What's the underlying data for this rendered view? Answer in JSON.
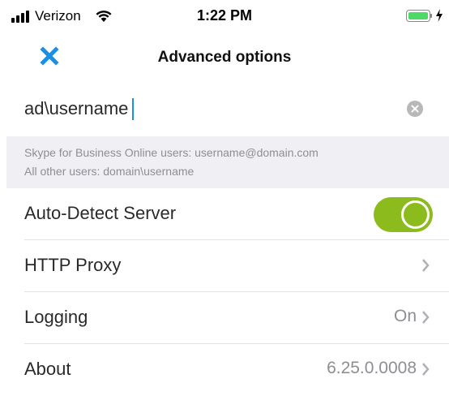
{
  "status_bar": {
    "carrier": "Verizon",
    "time": "1:22 PM",
    "battery_color": "#4cd964"
  },
  "nav": {
    "title": "Advanced options",
    "close_icon": "close-x-icon",
    "close_color": "#1a8fe3"
  },
  "username": {
    "value": "ad\\username",
    "clear_icon": "clear-circle-icon"
  },
  "hints": {
    "line1": "Skype for Business Online users: username@domain.com",
    "line2": "All other users: domain\\username"
  },
  "settings": [
    {
      "label": "Auto-Detect Server",
      "control": "toggle",
      "enabled": true,
      "toggle_color": "#8cbb1e"
    },
    {
      "label": "HTTP Proxy",
      "value": "",
      "icon": "chevron-right-icon"
    },
    {
      "label": "Logging",
      "value": "On",
      "icon": "chevron-right-icon"
    },
    {
      "label": "About",
      "value": "6.25.0.0008",
      "icon": "chevron-right-icon"
    }
  ]
}
